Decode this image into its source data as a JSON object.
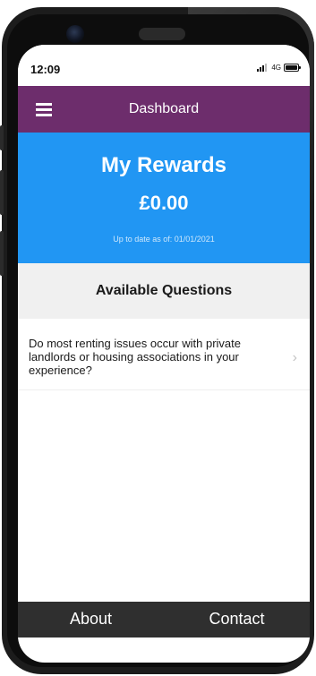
{
  "status_bar": {
    "time": "12:09",
    "network": "4G",
    "icons": [
      "signal-icon",
      "battery-icon"
    ]
  },
  "header": {
    "title": "Dashboard",
    "menu_icon": "menu-icon",
    "color": "#6d2d6c"
  },
  "rewards": {
    "title": "My Rewards",
    "amount": "£0.00",
    "updated": "Up to date as of: 01/01/2021",
    "color": "#2196f3"
  },
  "questions": {
    "heading": "Available Questions",
    "items": [
      {
        "text": "Do most renting issues occur with private landlords or housing associations in your experience?",
        "icon": "chevron-right-icon"
      }
    ]
  },
  "bottom_nav": {
    "about": "About",
    "contact": "Contact",
    "color": "#2f2f2f"
  }
}
